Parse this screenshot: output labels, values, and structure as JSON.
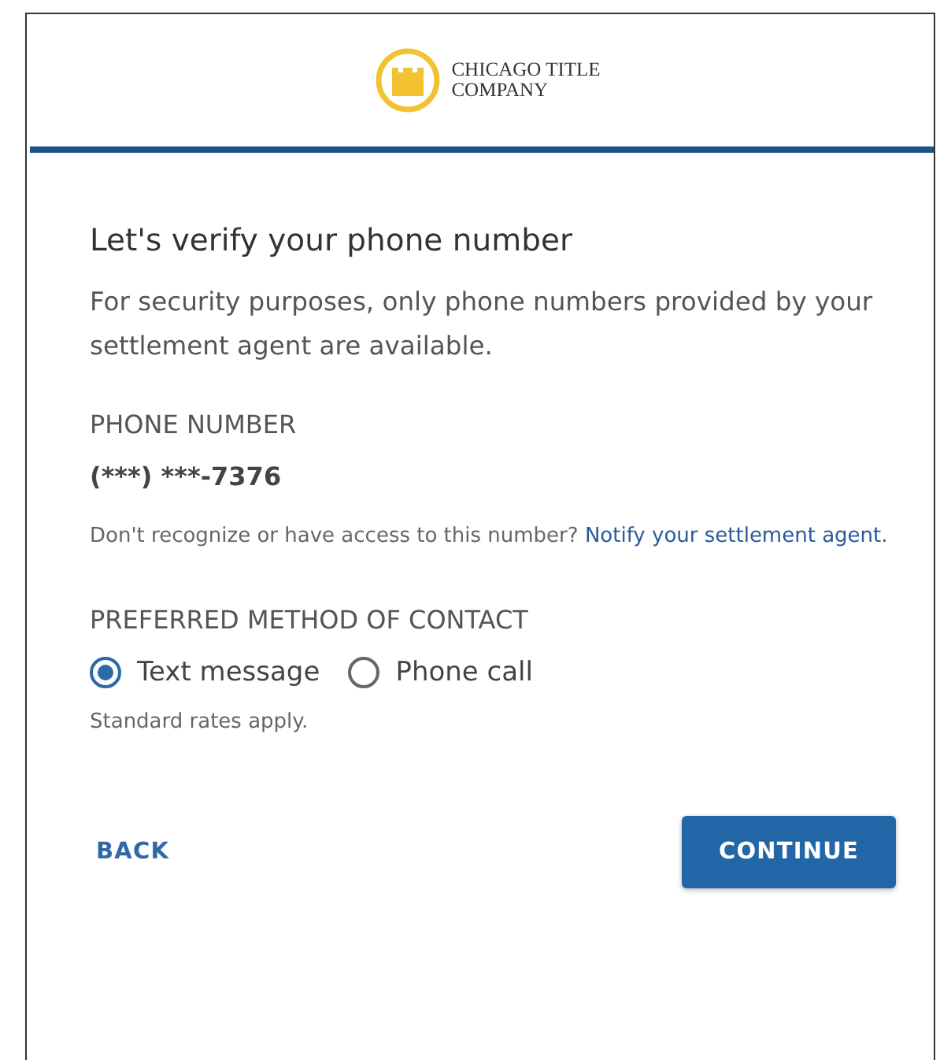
{
  "logo": {
    "line_1": "CHICAGO TITLE",
    "line_2": "COMPANY"
  },
  "title": "Let's verify your phone number",
  "intro": "For security purposes, only phone numbers provided by your settlement agent are available.",
  "phone": {
    "label": "PHONE NUMBER",
    "value": "(***) ***-7376"
  },
  "note": {
    "text": "Don't recognize or have access to this number?",
    "link": "Notify your settlement agent."
  },
  "contact": {
    "label": "PREFERRED METHOD OF CONTACT",
    "options": [
      {
        "label": "Text message",
        "selected": true
      },
      {
        "label": "Phone call",
        "selected": false
      }
    ],
    "hint": "Standard rates apply."
  },
  "buttons": [
    {
      "label": "BACK",
      "kind": "text"
    },
    {
      "label": "CONTINUE",
      "kind": "primary"
    }
  ]
}
